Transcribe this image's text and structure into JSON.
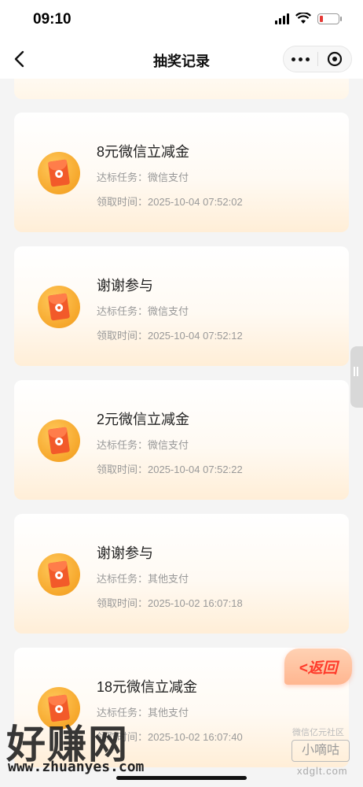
{
  "status": {
    "time": "09:10"
  },
  "nav": {
    "title": "抽奖记录"
  },
  "records": [
    {
      "title": "8元微信立减金",
      "task": "达标任务：微信支付",
      "time": "领取时间：2025-10-04 07:52:02"
    },
    {
      "title": "谢谢参与",
      "task": "达标任务：微信支付",
      "time": "领取时间：2025-10-04 07:52:12"
    },
    {
      "title": "2元微信立减金",
      "task": "达标任务：微信支付",
      "time": "领取时间：2025-10-04 07:52:22"
    },
    {
      "title": "谢谢参与",
      "task": "达标任务：其他支付",
      "time": "领取时间：2025-10-02 16:07:18"
    },
    {
      "title": "18元微信立减金",
      "task": "达标任务：其他支付",
      "time": "领取时间：2025-10-02 16:07:40"
    }
  ],
  "float_button": {
    "label": "<返回"
  },
  "watermark": {
    "haozhuan": "好赚网",
    "url": "www.zhuanyes.com",
    "small": "微信亿元社区",
    "xiaodi": "小嘀咕",
    "xdglt": "xdglt.com"
  },
  "colors": {
    "accent": "#f6a72b",
    "envelope": "#f25a2a",
    "back": "#ff3a2a"
  }
}
